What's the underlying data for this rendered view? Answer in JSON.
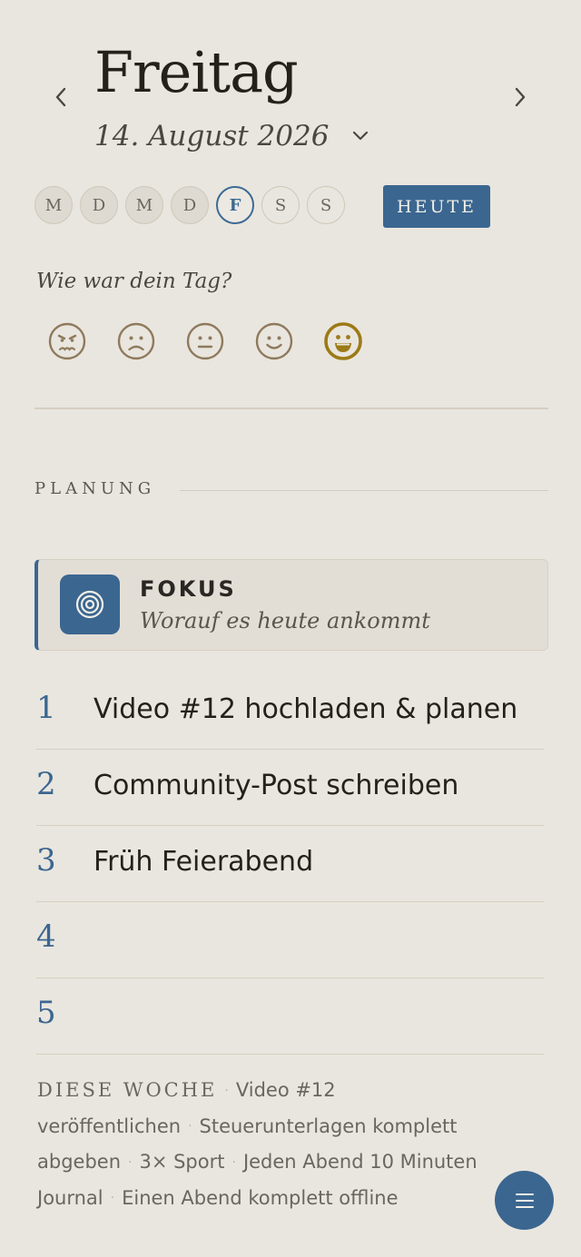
{
  "header": {
    "weekday": "Freitag",
    "date": "14. August 2026"
  },
  "week": {
    "days": [
      "M",
      "D",
      "M",
      "D",
      "F",
      "S",
      "S"
    ],
    "active_index": 4,
    "today_label": "HEUTE"
  },
  "mood": {
    "question": "Wie war dein Tag?",
    "options": [
      "angry-face-icon",
      "sad-face-icon",
      "neutral-face-icon",
      "smile-face-icon",
      "grin-face-icon"
    ],
    "selected_index": 4,
    "colors": {
      "default": "#8f7a5c",
      "selected": "#9c7a16"
    }
  },
  "planning": {
    "label": "PLANUNG",
    "focus": {
      "title": "FOKUS",
      "subtitle": "Worauf es heute ankommt",
      "icon": "target-icon"
    },
    "tasks": [
      {
        "num": "1",
        "text": "Video #12 hochladen & planen"
      },
      {
        "num": "2",
        "text": "Community-Post schreiben"
      },
      {
        "num": "3",
        "text": "Früh Feierabend"
      },
      {
        "num": "4",
        "text": ""
      },
      {
        "num": "5",
        "text": ""
      }
    ]
  },
  "week_goals": {
    "label": "DIESE WOCHE",
    "items": [
      "Video #12 veröffentlichen",
      "Steuerunterlagen komplett abgeben",
      "3× Sport",
      "Jeden Abend 10 Minuten Journal",
      "Einen Abend komplett offline"
    ]
  },
  "fab": {
    "icon": "menu-icon"
  },
  "colors": {
    "accent": "#3b6690",
    "background": "#e9e6df"
  }
}
